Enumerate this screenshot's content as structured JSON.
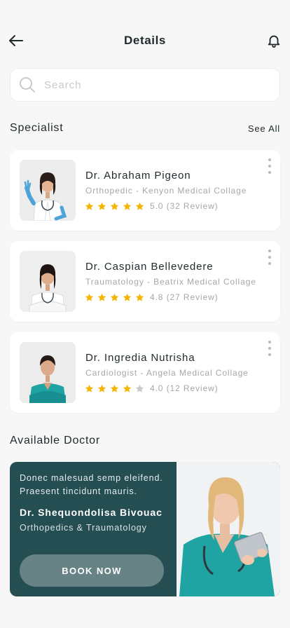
{
  "header": {
    "title": "Details",
    "back_icon": "arrow-left-icon",
    "bell_icon": "bell-icon"
  },
  "search": {
    "placeholder": "Search",
    "icon": "search-icon"
  },
  "specialist_section": {
    "title": "Specialist",
    "see_all": "See All"
  },
  "specialists": [
    {
      "name": "Dr. Abraham Pigeon",
      "specialty": "Orthopedic - Kenyon  Medical Collage",
      "stars": 5,
      "rating_text": "5.0 (32 Review)"
    },
    {
      "name": "Dr. Caspian Bellevedere",
      "specialty": "Traumatology - Beatrix Medical Collage",
      "stars": 5,
      "rating_text": "4.8 (27 Review)"
    },
    {
      "name": "Dr. Ingredia Nutrisha",
      "specialty": "Cardiologist - Angela Medical Collage",
      "stars": 4,
      "rating_text": "4.0 (12 Review)"
    }
  ],
  "available_section": {
    "title": "Available Doctor"
  },
  "banner": {
    "tagline": "Donec malesuad semp eleifend. Praesent tincidunt mauris.",
    "doctor_name": "Dr. Shequondolisa Bivouac",
    "specialty": "Orthopedics & Traumatology",
    "button_label": "BOOK NOW"
  },
  "colors": {
    "background": "#f7f7f7",
    "banner": "#254e52",
    "button": "#688385",
    "star_filled": "#f5b400",
    "star_empty": "#c7c9ca",
    "scrub_teal": "#1fa3a3"
  }
}
